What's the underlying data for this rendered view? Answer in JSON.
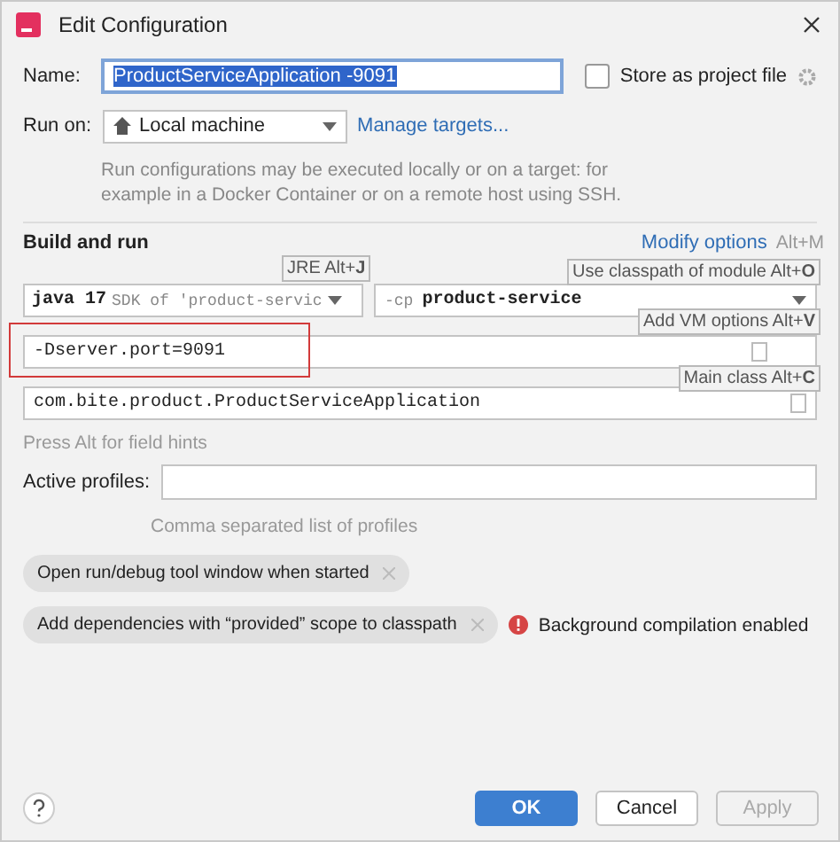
{
  "window": {
    "title": "Edit Configuration"
  },
  "name": {
    "label": "Name:",
    "value": "ProductServiceApplication -9091"
  },
  "store_as_project_file": {
    "label": "Store as project file",
    "checked": false
  },
  "run_on": {
    "label": "Run on:",
    "value": "Local machine",
    "link": "Manage targets...",
    "description": "Run configurations may be executed locally or on a target: for example in a Docker Container or on a remote host using SSH."
  },
  "build_and_run": {
    "title": "Build and run",
    "modify_options": "Modify options",
    "modify_shortcut": "Alt+M",
    "jre": {
      "version": "java 17",
      "detail": "SDK of 'product-servic"
    },
    "classpath": {
      "prefix": "-cp",
      "module": "product-service"
    },
    "vm_options": {
      "value": "-Dserver.port=9091",
      "highlighted": true
    },
    "main_class": {
      "value": "com.bite.product.ProductServiceApplication"
    },
    "hints": [
      {
        "kind": "jre",
        "text": "JRE Alt+**J**"
      },
      {
        "kind": "classpath",
        "text": "Use classpath of module Alt+**O**"
      },
      {
        "kind": "vm",
        "text": "Add VM options Alt+**V**"
      },
      {
        "kind": "main",
        "text": "Main class Alt+**C**"
      }
    ],
    "footer_hint": "Press Alt for field hints"
  },
  "active_profiles": {
    "label": "Active profiles:",
    "description": "Comma separated list of profiles"
  },
  "options": [
    {
      "label": "Open run/debug tool window when started"
    },
    {
      "label": "Add dependencies with “provided” scope to classpath",
      "warning": "Background compilation enabled"
    }
  ],
  "buttons": [
    {
      "label": "OK",
      "kind": "primary",
      "disabled": false
    },
    {
      "label": "Cancel",
      "kind": "normal",
      "disabled": false
    },
    {
      "label": "Apply",
      "kind": "normal",
      "disabled": true
    }
  ]
}
